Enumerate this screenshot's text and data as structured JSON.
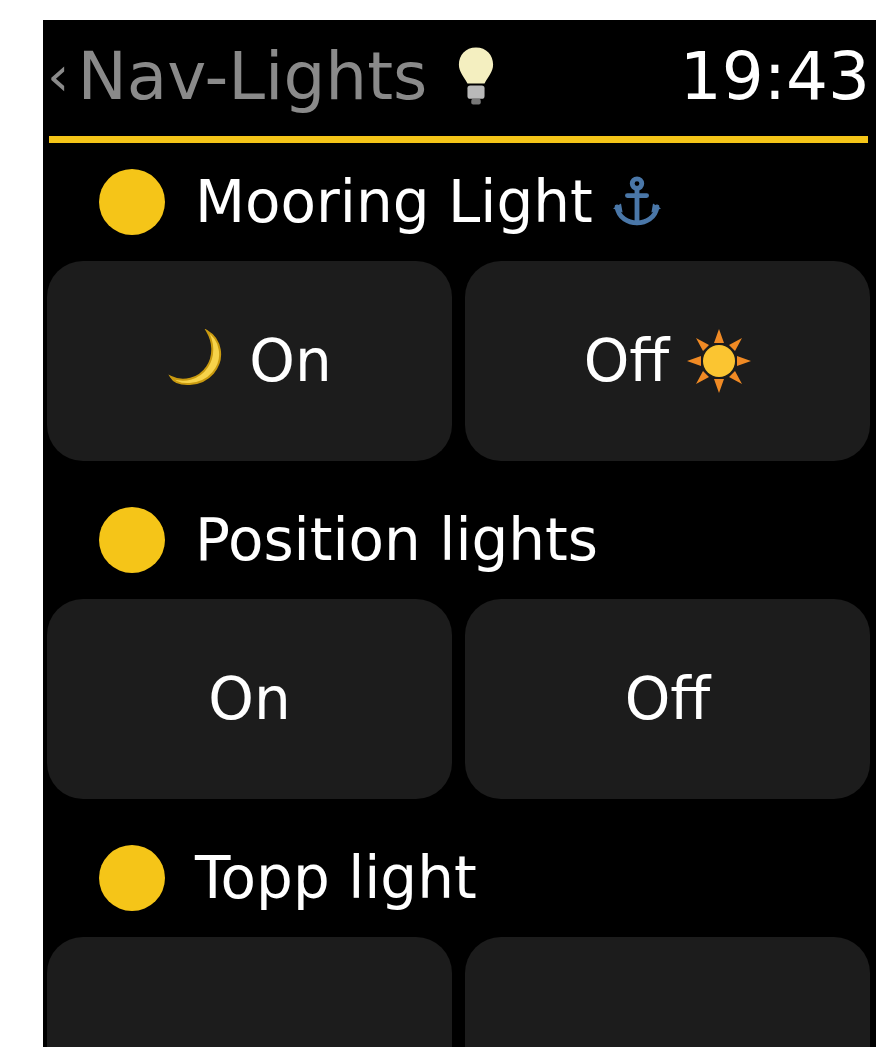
{
  "header": {
    "back": "‹",
    "title": "Nav-Lights",
    "time": "19:43"
  },
  "lights": [
    {
      "name": "Mooring Light",
      "color": "#f5c518",
      "kind": "anchored",
      "buttons": [
        {
          "label": "On",
          "kind": "night"
        },
        {
          "label": "Off",
          "kind": "day"
        }
      ]
    },
    {
      "name": "Position lights",
      "color": "#f5c518",
      "kind": "plain",
      "buttons": [
        {
          "label": "On",
          "kind": "plain"
        },
        {
          "label": "Off",
          "kind": "plain"
        }
      ]
    },
    {
      "name": "Topp light",
      "color": "#f5c518",
      "kind": "plain",
      "buttons": [
        {
          "kind": "blank"
        },
        {
          "kind": "blank"
        }
      ]
    }
  ]
}
